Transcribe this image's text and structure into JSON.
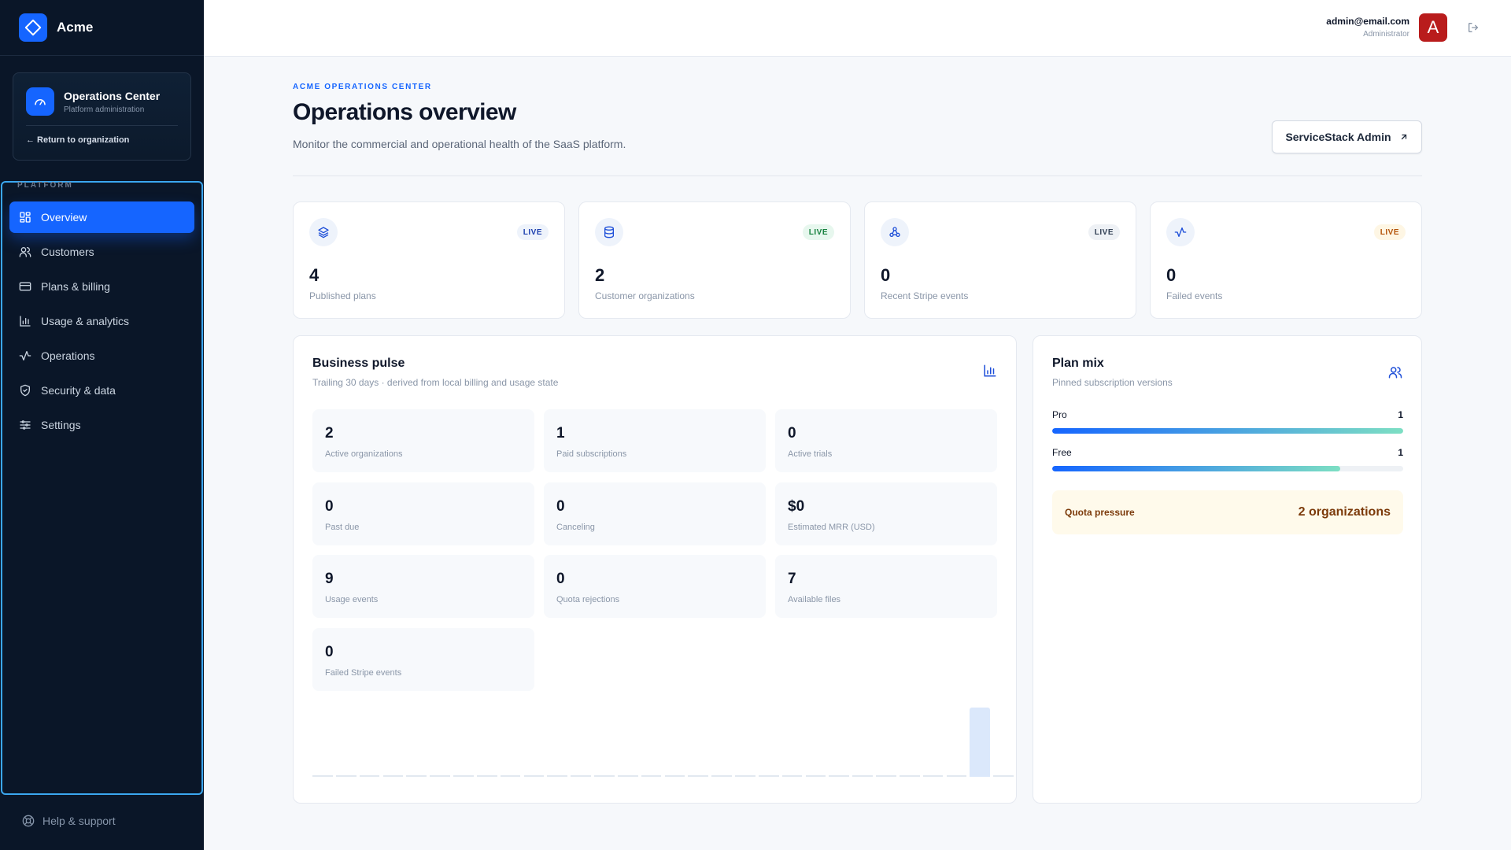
{
  "brand": {
    "name": "Acme"
  },
  "ops_card": {
    "title": "Operations Center",
    "subtitle": "Platform administration",
    "return_label": "← Return to organization"
  },
  "sidebar": {
    "section_label": "PLATFORM",
    "items": [
      {
        "label": "Overview",
        "icon": "grid-icon",
        "active": true
      },
      {
        "label": "Customers",
        "icon": "users-icon"
      },
      {
        "label": "Plans & billing",
        "icon": "credit-card-icon"
      },
      {
        "label": "Usage & analytics",
        "icon": "bar-chart-icon"
      },
      {
        "label": "Operations",
        "icon": "activity-icon"
      },
      {
        "label": "Security & data",
        "icon": "shield-icon"
      },
      {
        "label": "Settings",
        "icon": "sliders-icon"
      }
    ],
    "help_label": "Help & support"
  },
  "header": {
    "email": "admin@email.com",
    "role": "Administrator",
    "avatar_letter": "A"
  },
  "page": {
    "eyebrow": "ACME OPERATIONS CENTER",
    "title": "Operations overview",
    "description": "Monitor the commercial and operational health of the SaaS platform.",
    "admin_button": "ServiceStack Admin"
  },
  "stats": [
    {
      "value": "4",
      "label": "Published plans",
      "badge": "LIVE",
      "icon": "layers-icon"
    },
    {
      "value": "2",
      "label": "Customer organizations",
      "badge": "LIVE",
      "icon": "database-icon"
    },
    {
      "value": "0",
      "label": "Recent Stripe events",
      "badge": "LIVE",
      "icon": "webhook-icon"
    },
    {
      "value": "0",
      "label": "Failed events",
      "badge": "LIVE",
      "icon": "activity-icon"
    }
  ],
  "pulse": {
    "title": "Business pulse",
    "subtitle": "Trailing 30 days · derived from local billing and usage state",
    "metrics": [
      {
        "value": "2",
        "label": "Active organizations"
      },
      {
        "value": "1",
        "label": "Paid subscriptions"
      },
      {
        "value": "0",
        "label": "Active trials"
      },
      {
        "value": "0",
        "label": "Past due"
      },
      {
        "value": "0",
        "label": "Canceling"
      },
      {
        "value": "$0",
        "label": "Estimated MRR (USD)"
      },
      {
        "value": "9",
        "label": "Usage events"
      },
      {
        "value": "0",
        "label": "Quota rejections"
      },
      {
        "value": "7",
        "label": "Available files"
      },
      {
        "value": "0",
        "label": "Failed Stripe events"
      }
    ]
  },
  "chart_data": {
    "type": "bar",
    "categories": [],
    "values": [
      0,
      0,
      0,
      0,
      0,
      0,
      0,
      0,
      0,
      0,
      0,
      0,
      0,
      0,
      0,
      0,
      0,
      0,
      0,
      0,
      0,
      0,
      0,
      0,
      0,
      0,
      0,
      0,
      9,
      0
    ],
    "title": "",
    "xlabel": "",
    "ylabel": "",
    "ylim": [
      0,
      9
    ],
    "grid": false
  },
  "plan_mix": {
    "title": "Plan mix",
    "subtitle": "Pinned subscription versions",
    "plans": [
      {
        "name": "Pro",
        "count": "1",
        "fraction": 1.0
      },
      {
        "name": "Free",
        "count": "1",
        "fraction": 0.82
      }
    ],
    "quota_label": "Quota pressure",
    "quota_value": "2 organizations"
  },
  "colors": {
    "accent": "#1565ff",
    "sidebar": "#0a1628",
    "avatar": "#b91c1c"
  }
}
